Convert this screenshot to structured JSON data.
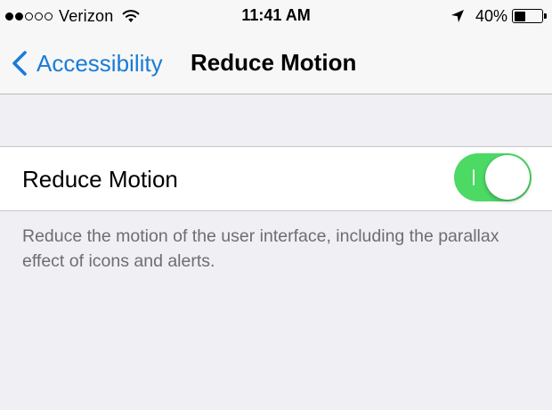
{
  "status_bar": {
    "signal_dots": [
      true,
      true,
      false,
      false,
      false
    ],
    "carrier": "Verizon",
    "time": "11:41 AM",
    "battery_percent": "40%",
    "battery_level": 0.4,
    "icons": [
      "signal-dots-icon",
      "wifi-icon",
      "location-arrow-icon",
      "battery-icon"
    ]
  },
  "nav": {
    "back_label": "Accessibility",
    "title": "Reduce Motion",
    "back_icon": "chevron-left-icon",
    "accent_color": "#1a7cd6"
  },
  "setting": {
    "label": "Reduce Motion",
    "toggle_on": true,
    "toggle_color": "#4cd964",
    "description": "Reduce the motion of the user interface, including the parallax effect of icons and alerts."
  },
  "colors": {
    "background": "#efeff4",
    "bar_background": "#f7f7f7",
    "footer_text": "#6d6d72"
  }
}
